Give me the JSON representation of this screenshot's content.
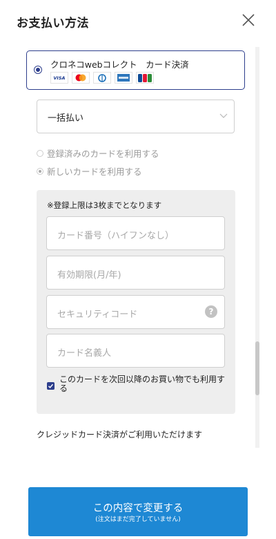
{
  "header": {
    "title": "お支払い方法",
    "close_icon": "close-icon"
  },
  "payment_method": {
    "label": "クロネコwebコレクト　カード決済",
    "selected": true,
    "brands": [
      "VISA",
      "Mastercard",
      "Diners Club",
      "AMEX",
      "JCB"
    ]
  },
  "installment": {
    "selected_value": "一括払い"
  },
  "card_options": [
    {
      "label": "登録済みのカードを利用する",
      "checked": false
    },
    {
      "label": "新しいカードを利用する",
      "checked": true
    }
  ],
  "card_form": {
    "note": "※登録上限は3枚までとなります",
    "card_number_placeholder": "カード番号（ハイフンなし）",
    "expiry_placeholder": "有効期限(月/年)",
    "security_code_placeholder": "セキュリティコード",
    "card_holder_placeholder": "カード名義人",
    "help_icon": "?",
    "save_card_label": "このカードを次回以降のお買い物でも利用する",
    "save_card_checked": true
  },
  "info_text": "クレジッドカード決済がご利用いただけます",
  "submit": {
    "main_label": "この内容で変更する",
    "sub_label": "(注文はまだ完了していません)"
  },
  "colors": {
    "accent": "#2d3e8c",
    "button": "#1e88d4",
    "form_background": "#eeeeee"
  }
}
